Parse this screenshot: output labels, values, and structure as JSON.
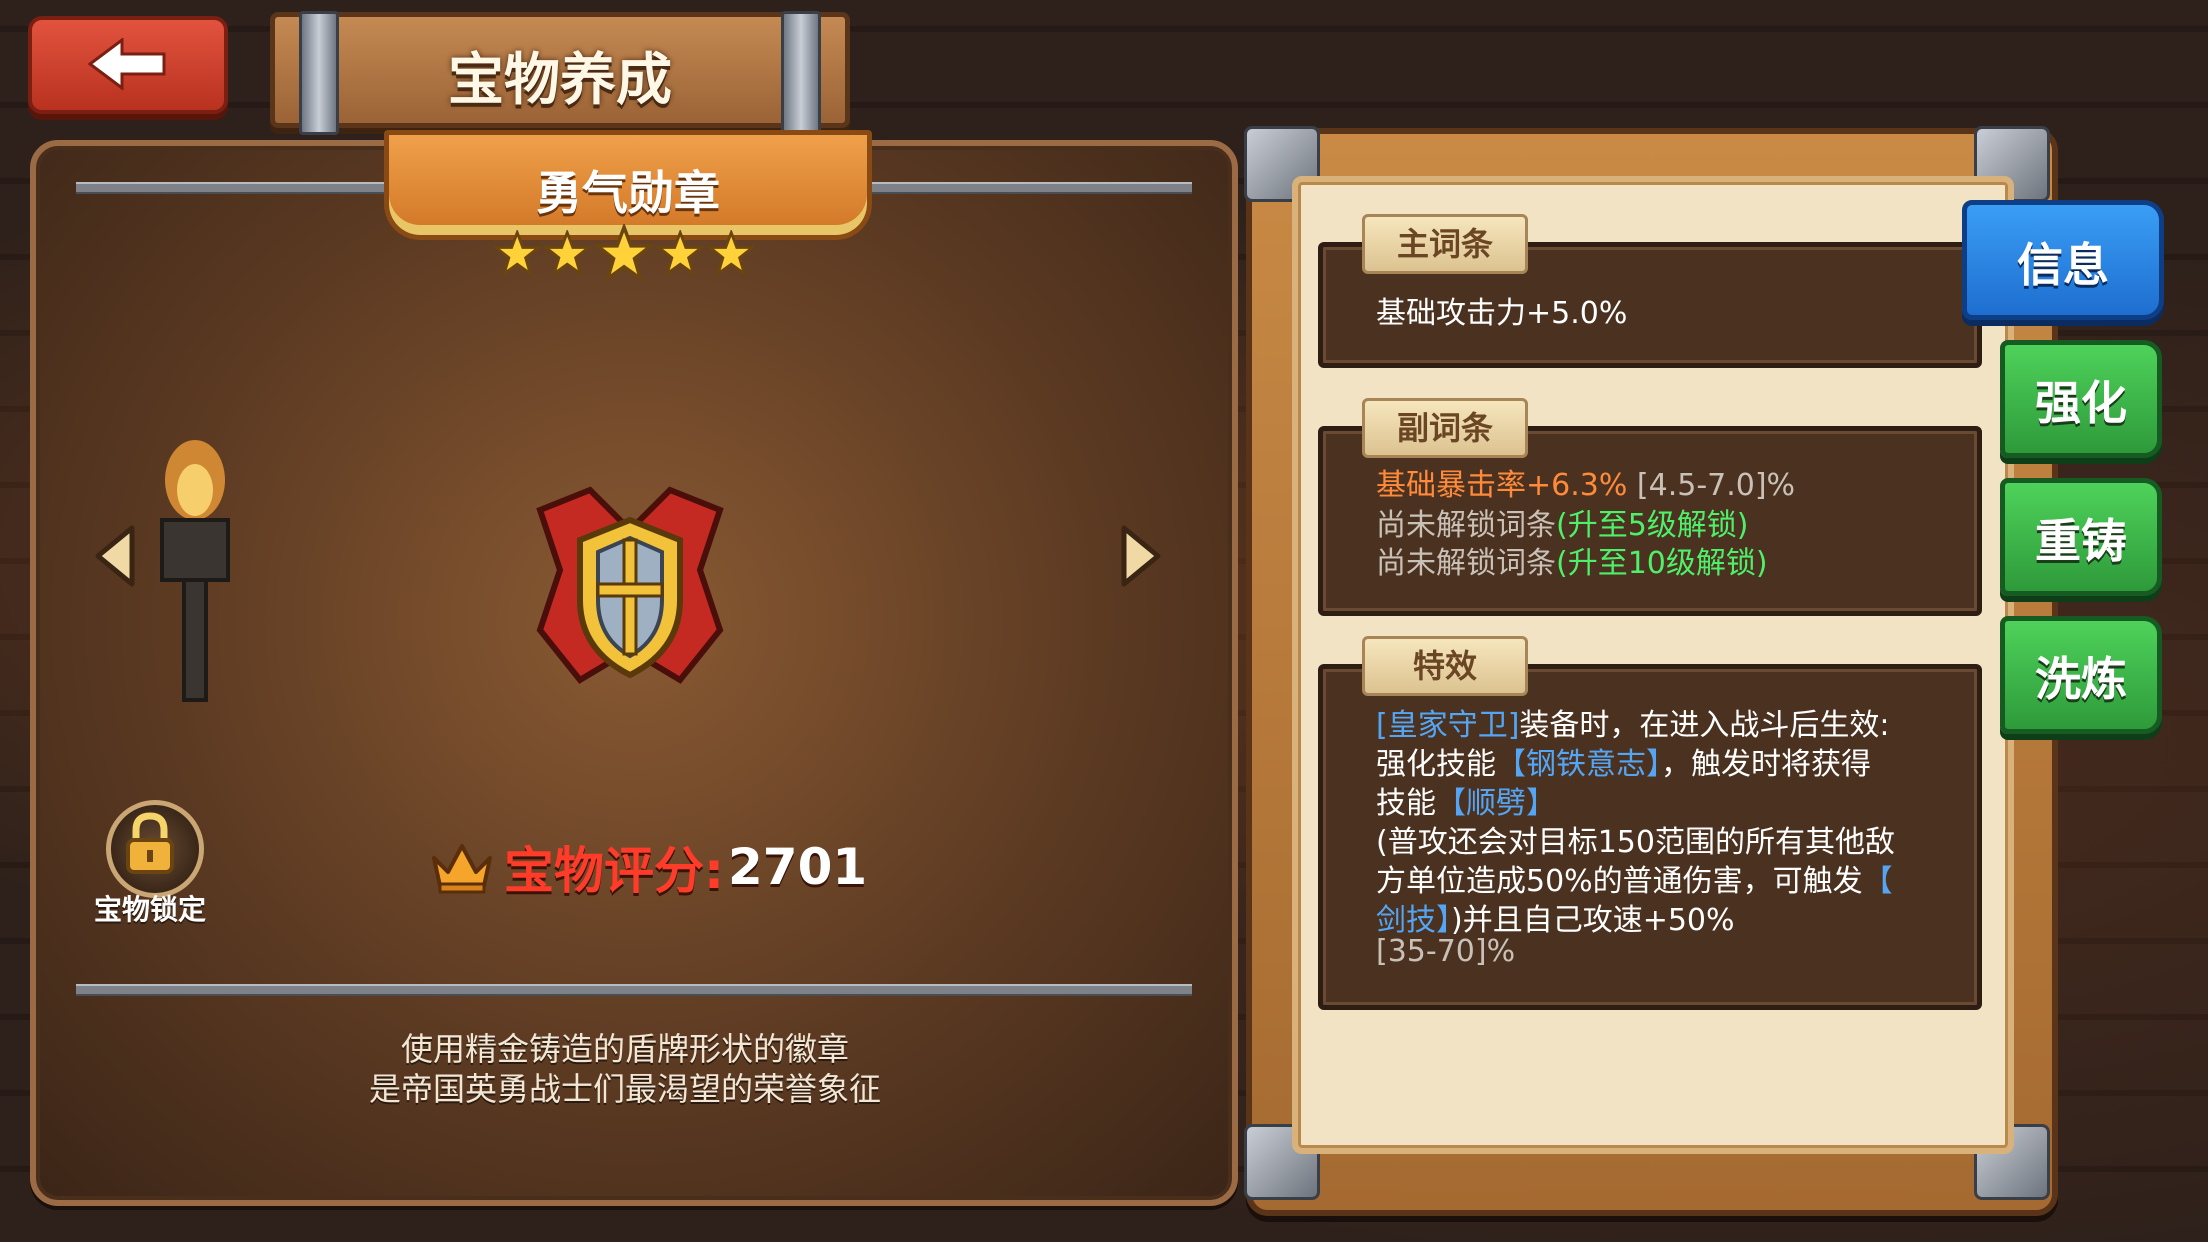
{
  "header": {
    "title": "宝物养成",
    "back_icon": "back-arrow-icon"
  },
  "treasure": {
    "name": "勇气勋章",
    "stars": 5,
    "lock_label": "宝物锁定",
    "score_label": "宝物评分:",
    "score_value": "2701",
    "description_line1": "使用精金铸造的盾牌形状的徽章",
    "description_line2": "是帝国英勇战士们最渴望的荣誉象征"
  },
  "info": {
    "main_attr": {
      "tag": "主词条",
      "value": "基础攻击力+5.0%"
    },
    "sub_attr": {
      "tag": "副词条",
      "line1_value": "基础暴击率+6.3%",
      "line1_range": "[4.5-7.0]%",
      "line2_text": "尚未解锁词条",
      "line2_hint": "(升至5级解锁)",
      "line3_text": "尚未解锁词条",
      "line3_hint": "(升至10级解锁)"
    },
    "effect": {
      "tag": "特效",
      "l1_skill": "[皇家守卫]",
      "l1_text": "装备时，在进入战斗后生效:",
      "l2_a": "强化技能",
      "l2_skill": "【钢铁意志】",
      "l2_b": "，触发时将获得",
      "l3_a": "技能",
      "l3_skill": "【顺劈】",
      "l4": "(普攻还会对目标150范围的所有其他敌",
      "l5_a": "方单位造成50%的普通伤害，可触发",
      "l5_skill": "【",
      "l6_skill": "剑技】",
      "l6_b": ")并且自己攻速+50%",
      "l7": "[35-70]%"
    }
  },
  "tabs": {
    "info": "信息",
    "enhance": "强化",
    "recast": "重铸",
    "refine": "洗炼"
  },
  "colors": {
    "score_red": "#ff3b2a",
    "sub_orange": "#ff8a3a",
    "hint_green": "#4ef06a",
    "skill_blue": "#54a6f5",
    "tab_green": "#3fb84b",
    "tab_blue": "#2a86e6"
  }
}
